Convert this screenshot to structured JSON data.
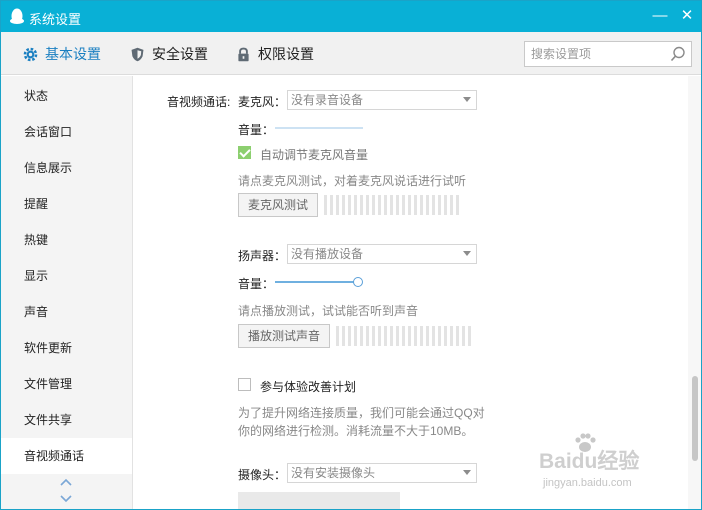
{
  "window": {
    "title": "系统设置",
    "minimize": "—",
    "close": "✕"
  },
  "tabs": [
    {
      "label": "基本设置",
      "icon": "gear-icon",
      "active": true
    },
    {
      "label": "安全设置",
      "icon": "shield-icon",
      "active": false
    },
    {
      "label": "权限设置",
      "icon": "lock-icon",
      "active": false
    }
  ],
  "search": {
    "placeholder": "搜索设置项",
    "value": ""
  },
  "sidebar": {
    "items": [
      {
        "label": "状态"
      },
      {
        "label": "会话窗口"
      },
      {
        "label": "信息展示"
      },
      {
        "label": "提醒"
      },
      {
        "label": "热键"
      },
      {
        "label": "显示"
      },
      {
        "label": "声音"
      },
      {
        "label": "软件更新"
      },
      {
        "label": "文件管理"
      },
      {
        "label": "文件共享"
      },
      {
        "label": "音视频通话",
        "active": true
      }
    ]
  },
  "content": {
    "section_label": "音视频通话:",
    "microphone": {
      "label": "麦克风：",
      "selected": "没有录音设备",
      "volume_label": "音量：",
      "volume_level": 0.0,
      "auto_adjust_label": "自动调节麦克风音量",
      "auto_adjust_checked": true,
      "test_hint": "请点麦克风测试，对着麦克风说话进行试听",
      "test_button": "麦克风测试"
    },
    "speaker": {
      "label": "扬声器：",
      "selected": "没有播放设备",
      "volume_label": "音量：",
      "volume_level": 1.0,
      "test_hint": "请点播放测试，试试能否听到声音",
      "test_button": "播放测试声音"
    },
    "experience": {
      "label": "参与体验改善计划",
      "checked": false,
      "desc_line1": "为了提升网络连接质量，我们可能会通过QQ对",
      "desc_line2": "你的网络进行检测。消耗流量不大于10MB。"
    },
    "camera": {
      "label": "摄像头：",
      "selected": "没有安装摄像头"
    }
  },
  "watermark": {
    "brand_text": "Baidu经验",
    "url_text": "jingyan.baidu.com"
  },
  "colors": {
    "titlebar": "#09b0d6",
    "accent": "#1a7fc1",
    "check_green": "#8ccf6f"
  }
}
